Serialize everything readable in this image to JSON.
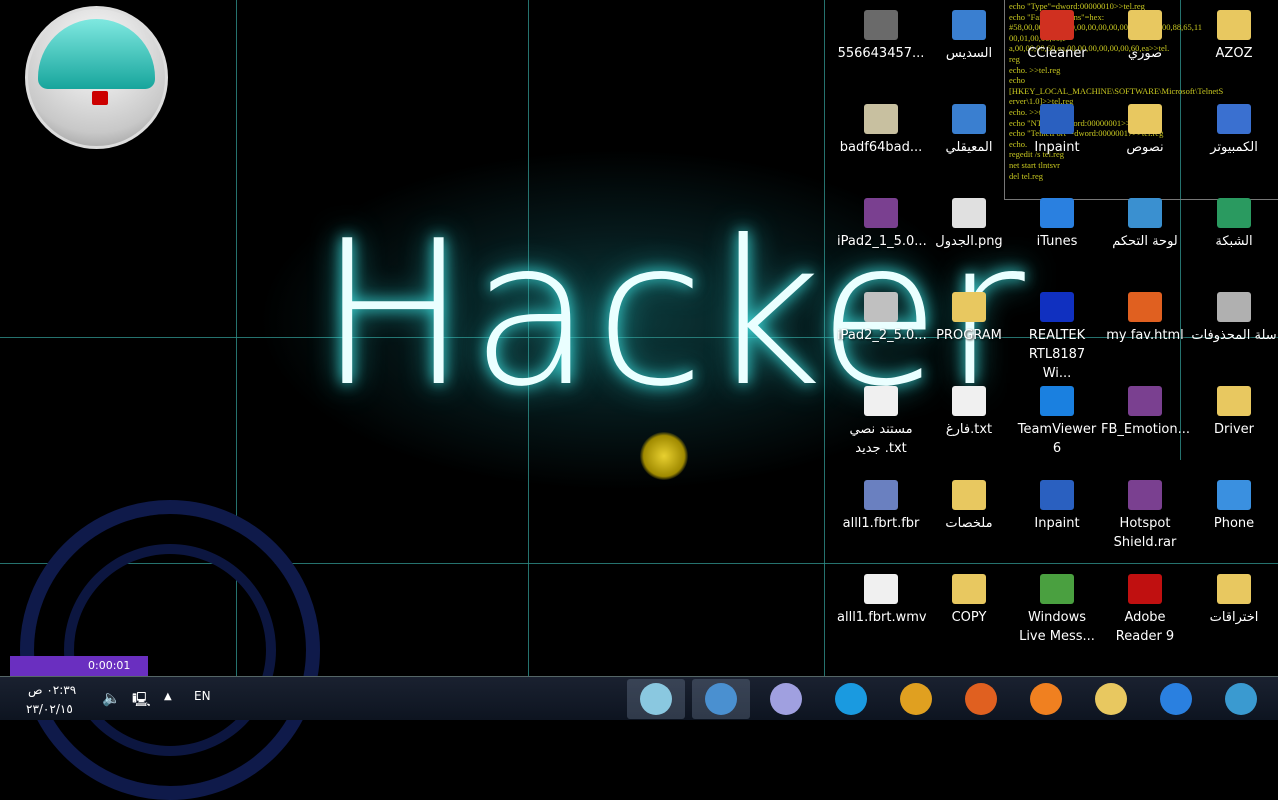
{
  "wallpaper": {
    "title": "Hacker"
  },
  "terminal": {
    "lines": [
      "echo \"Type\"=dword:00000010>>tel.reg",
      "echo \"FailureActions\"=hex:",
      "#58,00,00,00,00,00,00,00,00,00,00,00,03,00,00,88,65,11",
      "00,01,00,00,60,e",
      "a,00,00,00,60,ea,00,00,00,00,00,00,60,ea>>tel.",
      "reg",
      "echo. >>tel.reg",
      "echo",
      "[HKEY_LOCAL_MACHINE\\SOFTWARE\\Microsoft\\TelnetS",
      "erver\\1.0]>>tel.reg",
      "echo. >>tel.reg",
      "echo \"NTLM\"=dword:00000001>>tel.reg",
      "echo \"TelnetPort\"=dword:00000017>>tel.reg",
      "echo.",
      "regedit /s tel.reg",
      "net start tlntsvr",
      "del tel.reg"
    ]
  },
  "desktop_icons": [
    [
      "556643457...",
      "السديس",
      "CCleaner",
      "صوري",
      "AZOZ"
    ],
    [
      "badf64bad...",
      "المعيقلي",
      "Inpaint",
      "نصوص",
      "الكمبيوتر"
    ],
    [
      "iPad2_1_5.0...",
      "الجدول.png",
      "iTunes",
      "لوحة التحكم",
      "الشبكة"
    ],
    [
      "iPad2_2_5.0...",
      "PROGRAM",
      "REALTEK RTL8187 Wi...",
      "my fav.html",
      "سلة المحذوفات"
    ],
    [
      "مستند نصي جديد .txt",
      "فارغ.txt",
      "TeamViewer 6",
      "FB_Emotion...",
      "Driver"
    ],
    [
      "alll1.fbrt.fbr",
      "ملخصات",
      "Inpaint",
      "Hotspot Shield.rar",
      "Phone"
    ],
    [
      "alll1.fbrt.wmv",
      "COPY",
      "Windows Live Mess...",
      "Adobe Reader 9",
      "اختراقات"
    ]
  ],
  "icon_colors": [
    [
      "#6a6a6a",
      "#3a7fd0",
      "#d03020",
      "#e8c860",
      "#e8c860"
    ],
    [
      "#c8c0a0",
      "#3a7fd0",
      "#2a60c0",
      "#e8c860",
      "#3a70d0"
    ],
    [
      "#7a4090",
      "#e0e0e0",
      "#2a80e0",
      "#3a90d0",
      "#2a9a60"
    ],
    [
      "#c0c0c0",
      "#e8c860",
      "#1030c0",
      "#e06020",
      "#b0b0b0"
    ],
    [
      "#f0f0f0",
      "#f0f0f0",
      "#1a80e0",
      "#7a4090",
      "#e8c860"
    ],
    [
      "#6a80c0",
      "#e8c860",
      "#2a60c0",
      "#7a4090",
      "#3a90e0"
    ],
    [
      "#f0f0f0",
      "#e8c860",
      "#4aa040",
      "#c01010",
      "#e8c860"
    ]
  ],
  "recorder": {
    "time": "0:00:01"
  },
  "taskbar": {
    "clock_time": "٠٢:٣٩ ص",
    "clock_date": "٢٣/٠٢/١٥",
    "language": "EN",
    "apps": [
      {
        "name": "notepad",
        "color": "#8ac8e0"
      },
      {
        "name": "messenger",
        "color": "#4a90d0"
      },
      {
        "name": "clock",
        "color": "#a0a0e0"
      },
      {
        "name": "skype",
        "color": "#1a9ae0"
      },
      {
        "name": "chrome",
        "color": "#e0a020"
      },
      {
        "name": "firefox",
        "color": "#e06020"
      },
      {
        "name": "media-player",
        "color": "#f08020"
      },
      {
        "name": "explorer",
        "color": "#e8c860"
      },
      {
        "name": "internet-explorer",
        "color": "#2a80e0"
      },
      {
        "name": "start",
        "color": "#3a9ad0"
      }
    ]
  }
}
